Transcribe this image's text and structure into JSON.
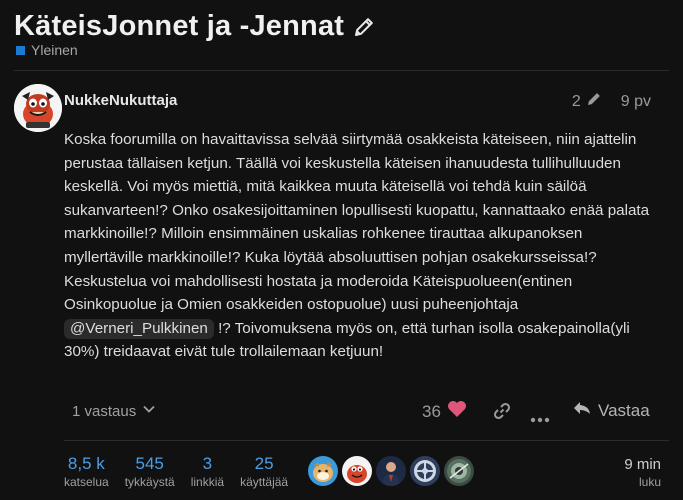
{
  "topic": {
    "title": "KäteisJonnet ja -Jennat",
    "category": "Yleinen",
    "category_color": "#1b7bd3"
  },
  "post": {
    "username": "NukkeNukuttaja",
    "edit_count": "2",
    "date": "9 pv",
    "body_before_mention": "Koska foorumilla on havaittavissa selvää siirtymää osakkeista käteiseen, niin ajattelin perustaa tällaisen ketjun. Täällä voi keskustella käteisen ihanuudesta tullihulluuden keskellä. Voi myös miettiä, mitä kaikkea muuta käteisellä voi tehdä kuin säilöä sukanvarteen!? Onko osakesijoittaminen lopullisesti kuopattu, kannattaako enää palata markkinoille!? Milloin ensimmäinen uskalias rohkenee tirauttaa alkupanoksen myllertäville markkinoille!? Kuka löytää absoluuttisen pohjan osakekursseissa!? Keskustelua voi mahdollisesti hostata ja moderoida Käteispuolueen(entinen Osinkopuolue ja Omien osakkeiden ostopuolue) uusi puheenjohtaja",
    "mention": "@Verneri_Pulkkinen",
    "body_after_mention": " !? Toivomuksena myös on, että turhan isolla osakepainolla(yli 30%) treidaavat eivät tule trollailemaan ketjuun!"
  },
  "actions": {
    "replies_label": "1 vastaus",
    "like_count": "36",
    "reply_label": "Vastaa"
  },
  "stats": [
    {
      "value": "8,5 k",
      "label": "katselua"
    },
    {
      "value": "545",
      "label": "tykkäystä"
    },
    {
      "value": "3",
      "label": "linkkiä"
    },
    {
      "value": "25",
      "label": "käyttäjää"
    }
  ],
  "read_time": {
    "value": "9 min",
    "label": "luku"
  },
  "colors": {
    "background": "#111111",
    "accent_blue": "#4a9fe8",
    "heart": "#e0557a"
  },
  "icons": [
    "pencil-icon",
    "chevron-down-icon",
    "heart-icon",
    "link-icon",
    "ellipsis-icon",
    "reply-icon"
  ]
}
